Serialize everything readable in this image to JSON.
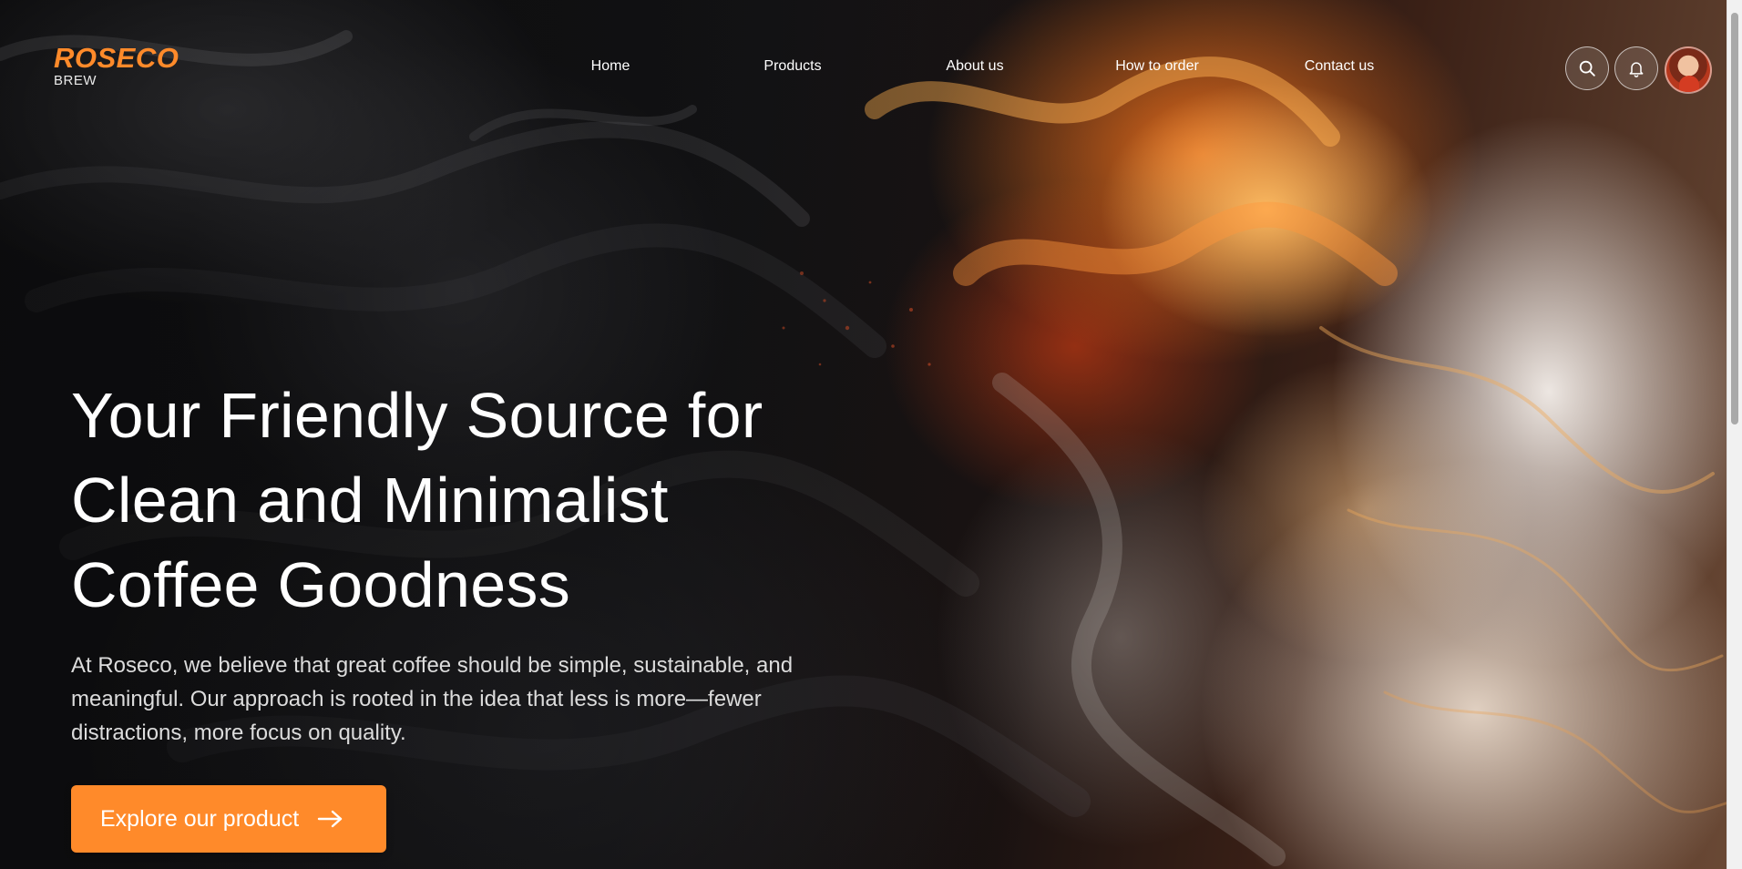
{
  "brand": {
    "name": "ROSECO",
    "sub": "BREW",
    "accent_color": "#ff8a2a"
  },
  "nav": {
    "items": [
      {
        "label": "Home"
      },
      {
        "label": "Products"
      },
      {
        "label": "About us"
      },
      {
        "label": "How to order"
      },
      {
        "label": "Contact us"
      }
    ]
  },
  "header_actions": {
    "search_icon": "search-icon",
    "notification_icon": "bell-icon",
    "avatar": "user-avatar"
  },
  "hero": {
    "title_lines": [
      "Your Friendly Source for",
      "Clean and Minimalist",
      "Coffee Goodness"
    ],
    "description_lines": [
      "At Roseco, we believe that great coffee should be simple, sustainable, and",
      "meaningful. Our approach is rooted in the idea that less is more—fewer",
      "distractions, more focus on quality."
    ],
    "cta_label": "Explore our product",
    "cta_icon": "arrow-right-icon"
  }
}
